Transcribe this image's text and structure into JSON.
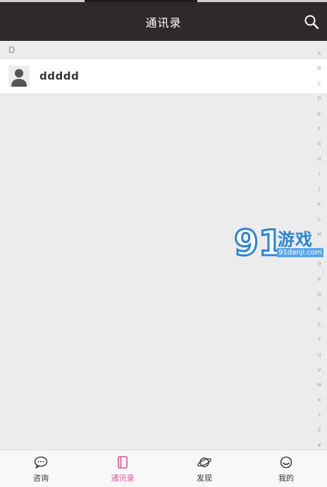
{
  "header": {
    "title": "通讯录",
    "search_icon": "search-icon"
  },
  "section": {
    "letter": "D"
  },
  "contacts": [
    {
      "name": "ddddd",
      "icon": "person-icon"
    }
  ],
  "index_letters": [
    "A",
    "B",
    "C",
    "D",
    "E",
    "F",
    "G",
    "H",
    "I",
    "J",
    "K",
    "L",
    "M",
    "N",
    "O",
    "P",
    "Q",
    "R",
    "S",
    "T",
    "U",
    "V",
    "W",
    "X",
    "Y",
    "Z",
    "#"
  ],
  "watermark": {
    "logo_text": "91",
    "cn": "游戏",
    "url": "91danji.com"
  },
  "tabs": [
    {
      "label": "咨询",
      "icon": "chat-bubble-icon",
      "active": false
    },
    {
      "label": "通讯录",
      "icon": "address-book-icon",
      "active": true
    },
    {
      "label": "发现",
      "icon": "planet-icon",
      "active": false
    },
    {
      "label": "我的",
      "icon": "smiley-icon",
      "active": false
    }
  ],
  "colors": {
    "header_bg": "#2f2a2a",
    "accent": "#e0509a",
    "background": "#ececec",
    "watermark_blue": "#2a84d6"
  }
}
